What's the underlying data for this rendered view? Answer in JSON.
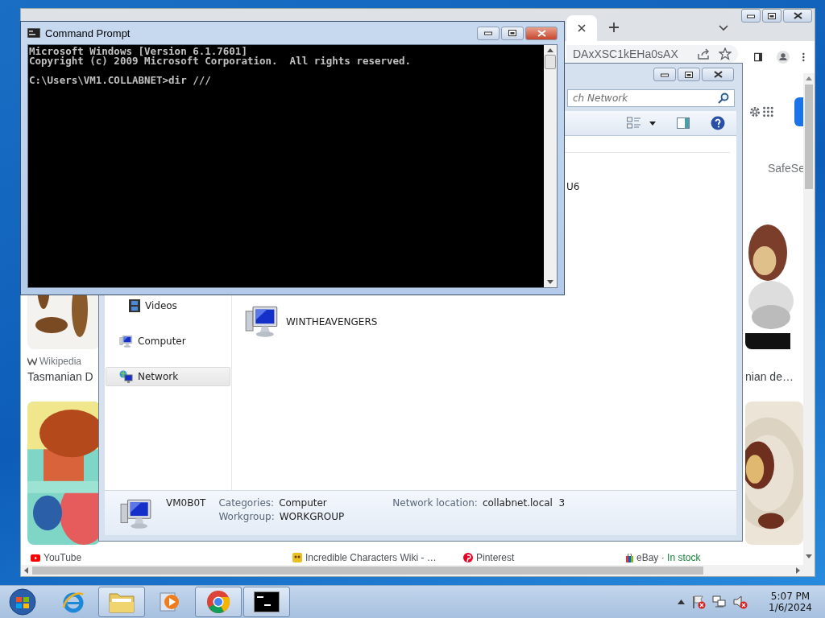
{
  "browser": {
    "address": "DAxXSC1kEHa0sAX",
    "safe_search_label": "SafeSe",
    "left_column": {
      "source": "Wikipedia",
      "title": "Tasmanian D"
    },
    "right_column": {
      "title": "nian de…"
    },
    "bottom_sources": [
      {
        "name": "YouTube",
        "kind": "youtube"
      },
      {
        "name": "Incredible Characters Wiki - …",
        "kind": "wiki"
      },
      {
        "name": "Pinterest",
        "kind": "pinterest"
      },
      {
        "name": "eBay",
        "kind": "shop",
        "separator": "·",
        "note": "In stock"
      }
    ]
  },
  "explorer": {
    "search_placeholder": "ch Network",
    "nav": [
      {
        "label": "Videos",
        "kind": "videos",
        "selected": false
      },
      {
        "label": "Computer",
        "kind": "computer",
        "selected": false
      },
      {
        "label": "Network",
        "kind": "network",
        "selected": true
      }
    ],
    "items": [
      {
        "label": "U6",
        "kind": "text"
      },
      {
        "label": "WINTHEAVENGERS",
        "kind": "computer"
      }
    ],
    "details": {
      "name": "VM0B0T",
      "fields": [
        {
          "label": "Categories:",
          "value": "Computer"
        },
        {
          "label": "Workgroup:",
          "value": "WORKGROUP"
        },
        {
          "label": "Network location:",
          "value": "collabnet.local  3"
        }
      ]
    }
  },
  "command_prompt": {
    "title": "Command Prompt",
    "banner": [
      "Microsoft Windows [Version 6.1.7601]",
      "Copyright (c) 2009 Microsoft Corporation.  All rights reserved."
    ],
    "prompt": "C:\\Users\\VM1.COLLABNET>dir ///"
  },
  "taskbar": {
    "apps": [
      {
        "kind": "ie",
        "running": false
      },
      {
        "kind": "folder",
        "running": true
      },
      {
        "kind": "media",
        "running": false
      },
      {
        "kind": "chrome",
        "running": true
      },
      {
        "kind": "console",
        "running": true
      }
    ],
    "time": "5:07 PM",
    "date": "1/6/2024"
  }
}
